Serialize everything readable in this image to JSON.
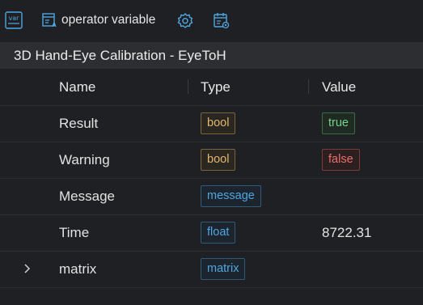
{
  "toolbar": {
    "var_icon_text": "var",
    "operator_label": "operator variable"
  },
  "panel": {
    "title": "3D Hand-Eye Calibration - EyeToH"
  },
  "table": {
    "headers": {
      "name": "Name",
      "type": "Type",
      "value": "Value"
    },
    "rows": [
      {
        "name": "Result",
        "type": "bool",
        "value": "true"
      },
      {
        "name": "Warning",
        "type": "bool",
        "value": "false"
      },
      {
        "name": "Message",
        "type": "message",
        "value": ""
      },
      {
        "name": "Time",
        "type": "float",
        "value": "8722.31"
      },
      {
        "name": "matrix",
        "type": "matrix",
        "value": ""
      }
    ]
  },
  "colors": {
    "accent_blue": "#4fa6e2",
    "bool_orange": "#e4b86a",
    "true_green": "#74d48a",
    "false_red": "#ef6c6c"
  }
}
